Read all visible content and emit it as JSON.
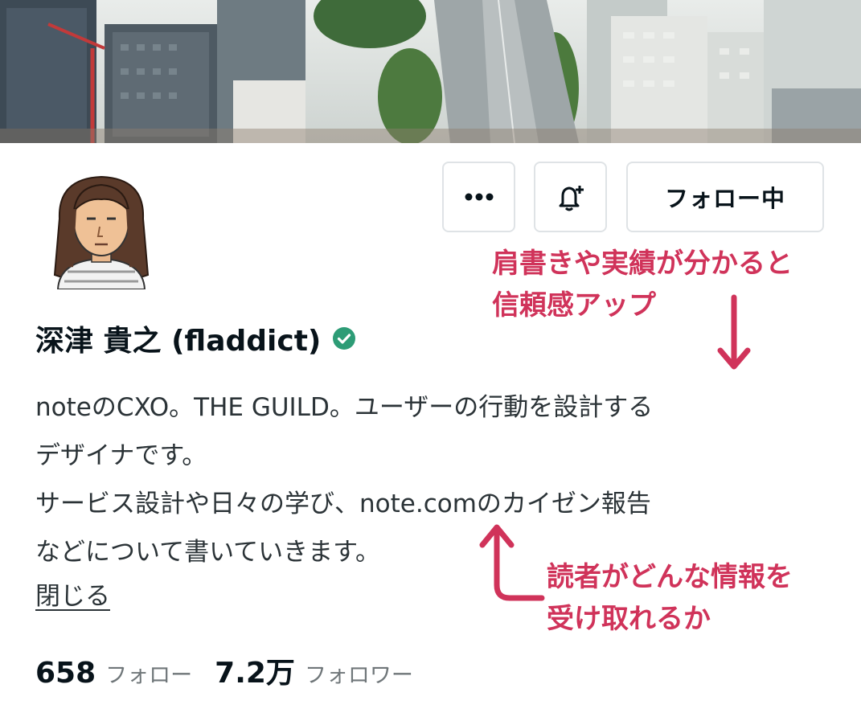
{
  "header": {
    "more_icon": "ellipsis-icon",
    "notify_icon": "bell-plus-icon",
    "follow_label": "フォロー中"
  },
  "profile": {
    "name": "深津 貴之 (fladdict)",
    "verified_icon": "verified-check-icon",
    "bio_lines": [
      "noteのCXO。THE GUILD。ユーザーの行動を設計する",
      "デザイナです。",
      "サービス設計や日々の学び、note.comのカイゼン報告",
      "などについて書いていきます。"
    ],
    "close_label": "閉じる"
  },
  "stats": {
    "following_count": "658",
    "following_label": "フォロー",
    "followers_count": "7.2万",
    "followers_label": "フォロワー"
  },
  "annotations": {
    "credibility": [
      "肩書きや実績が分かると",
      "信頼感アップ"
    ],
    "reader_info": [
      "読者がどんな情報を",
      "受け取れるか"
    ]
  },
  "colors": {
    "accent": "#d0335a",
    "verified": "#2d9c76",
    "border": "#dfe3e6",
    "muted_text": "#6f7679"
  }
}
